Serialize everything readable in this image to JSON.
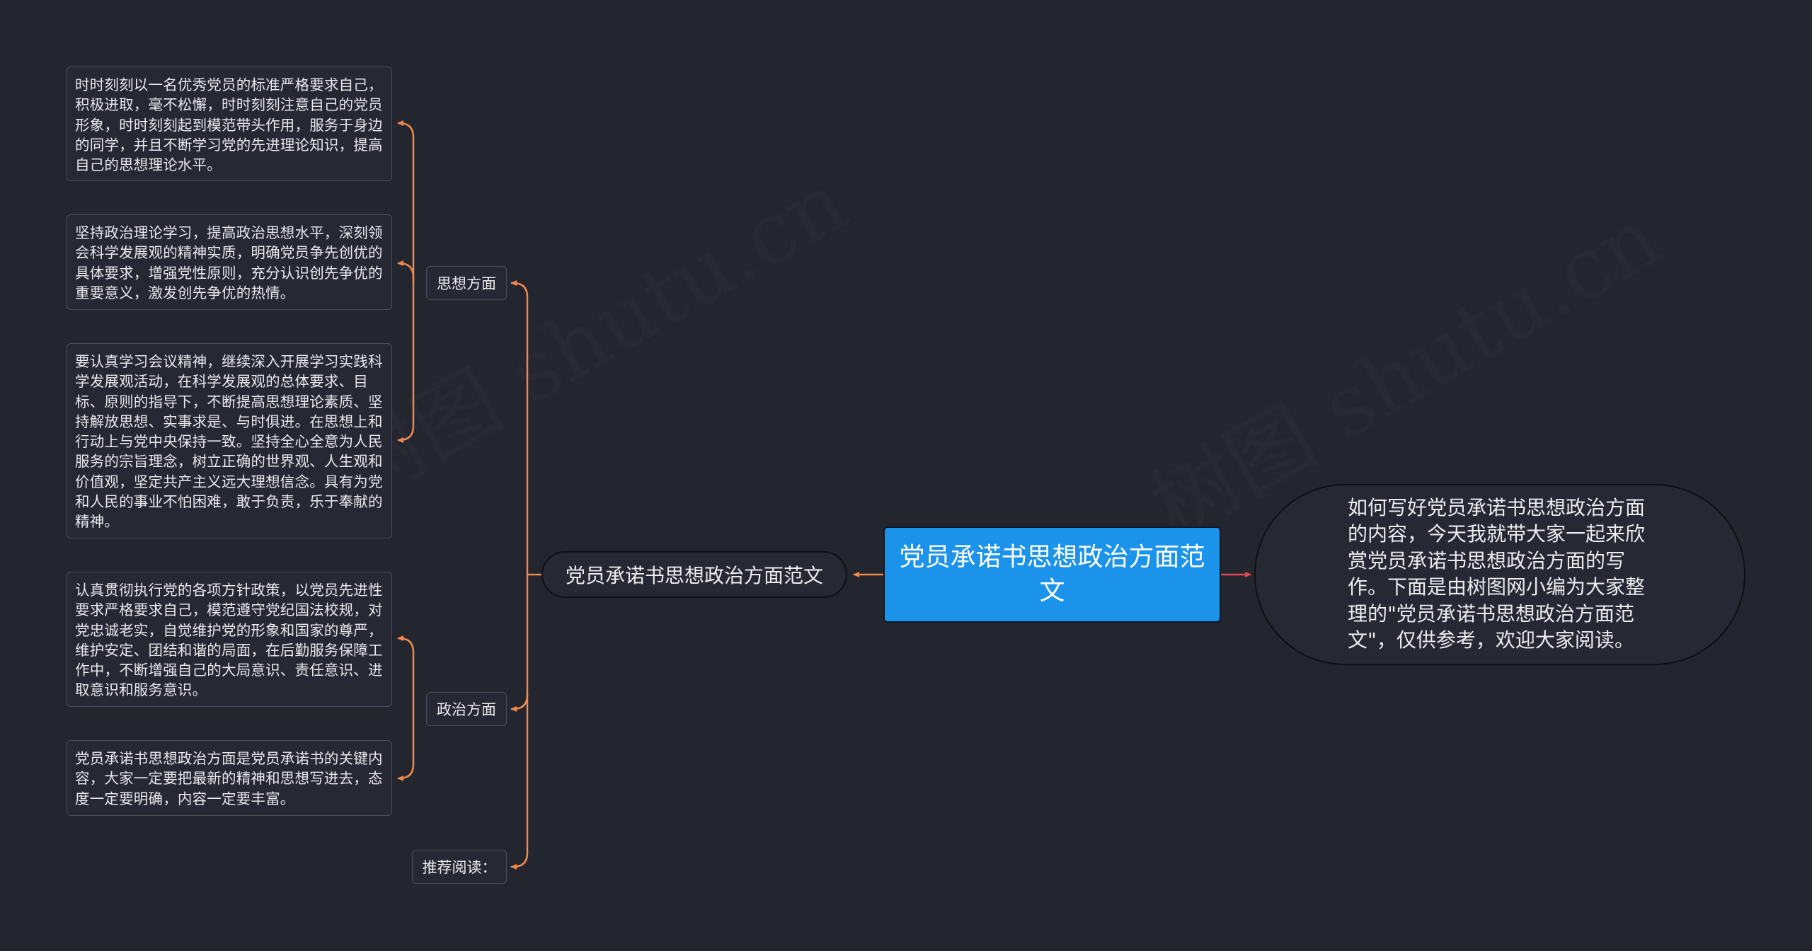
{
  "root": {
    "label": "党员承诺书思想政治方面范文"
  },
  "summary": {
    "text": "如何写好党员承诺书思想政治方面的内容，今天我就带大家一起来欣赏党员承诺书思想政治方面的写作。下面是由树图网小编为大家整理的\"党员承诺书思想政治方面范文\"，仅供参考，欢迎大家阅读。"
  },
  "branch": {
    "label": "党员承诺书思想政治方面范文"
  },
  "sections": [
    {
      "label": "思想方面",
      "items": [
        "时时刻刻以一名优秀党员的标准严格要求自己，积极进取，毫不松懈，时时刻刻注意自己的党员形象，时时刻刻起到模范带头作用，服务于身边的同学，并且不断学习党的先进理论知识，提高自己的思想理论水平。",
        "坚持政治理论学习，提高政治思想水平，深刻领会科学发展观的精神实质，明确党员争先创优的具体要求，增强党性原则，充分认识创先争优的重要意义，激发创先争优的热情。",
        "要认真学习会议精神，继续深入开展学习实践科学发展观活动，在科学发展观的总体要求、目标、原则的指导下，不断提高思想理论素质、坚持解放思想、实事求是、与时俱进。在思想上和行动上与党中央保持一致。坚持全心全意为人民服务的宗旨理念，树立正确的世界观、人生观和价值观，坚定共产主义远大理想信念。具有为党和人民的事业不怕困难，敢于负责，乐于奉献的精神。"
      ]
    },
    {
      "label": "政治方面",
      "items": [
        "认真贯彻执行党的各项方针政策，以党员先进性要求严格要求自己，模范遵守党纪国法校规，对党忠诚老实，自觉维护党的形象和国家的尊严，维护安定、团结和谐的局面，在后勤服务保障工作中，不断增强自己的大局意识、责任意识、进取意识和服务意识。",
        "党员承诺书思想政治方面是党员承诺书的关键内容，大家一定要把最新的精神和思想写进去，态度一定要明确，内容一定要丰富。"
      ]
    },
    {
      "label": "推荐阅读：",
      "items": []
    }
  ],
  "watermark": {
    "text": "树图 shutu.cn"
  },
  "colors": {
    "background": "#23252f",
    "root_fill": "#1b93ea",
    "connector_left": "#f08a4b",
    "connector_right": "#e5484d",
    "node_border": "#4a4d5c"
  }
}
